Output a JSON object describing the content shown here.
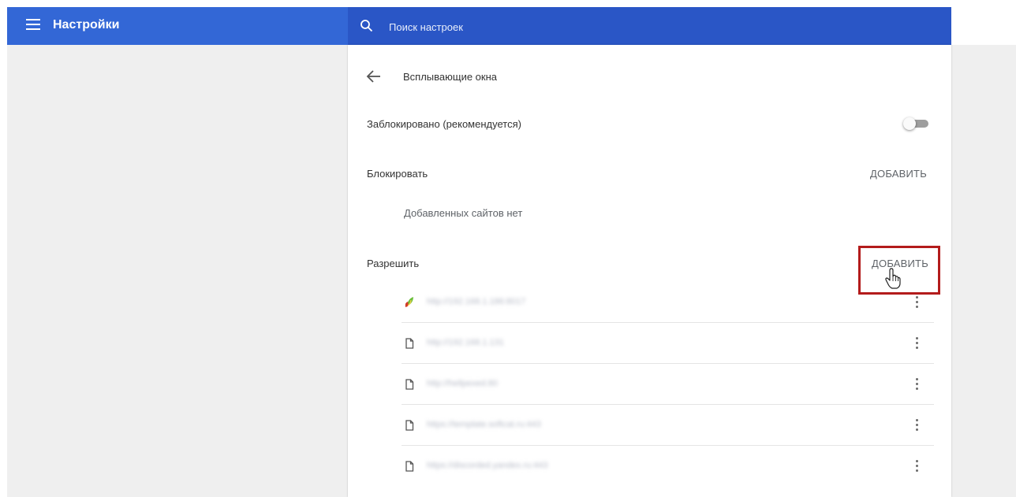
{
  "header": {
    "title": "Настройки",
    "search_placeholder": "Поиск настроек"
  },
  "page": {
    "title": "Всплывающие окна",
    "blocked_label": "Заблокировано (рекомендуется)",
    "blocked_enabled": false
  },
  "block_section": {
    "label": "Блокировать",
    "add_label": "ДОБАВИТЬ",
    "empty_text": "Добавленных сайтов нет"
  },
  "allow_section": {
    "label": "Разрешить",
    "add_label": "ДОБАВИТЬ",
    "sites": [
      {
        "url": "http://192.168.1.186:8017",
        "icon": "site-favicon-icon"
      },
      {
        "url": "http://192.168.1.131",
        "icon": "file-icon"
      },
      {
        "url": "http://hellpexed.80",
        "icon": "file-icon"
      },
      {
        "url": "https://template.softcat.ru:443",
        "icon": "file-icon"
      },
      {
        "url": "https://discorded.yandex.ru:443",
        "icon": "file-icon"
      }
    ]
  },
  "colors": {
    "header_bg": "#3367d6",
    "search_bg": "#2a56c6",
    "highlight_border": "#b31b1b"
  }
}
